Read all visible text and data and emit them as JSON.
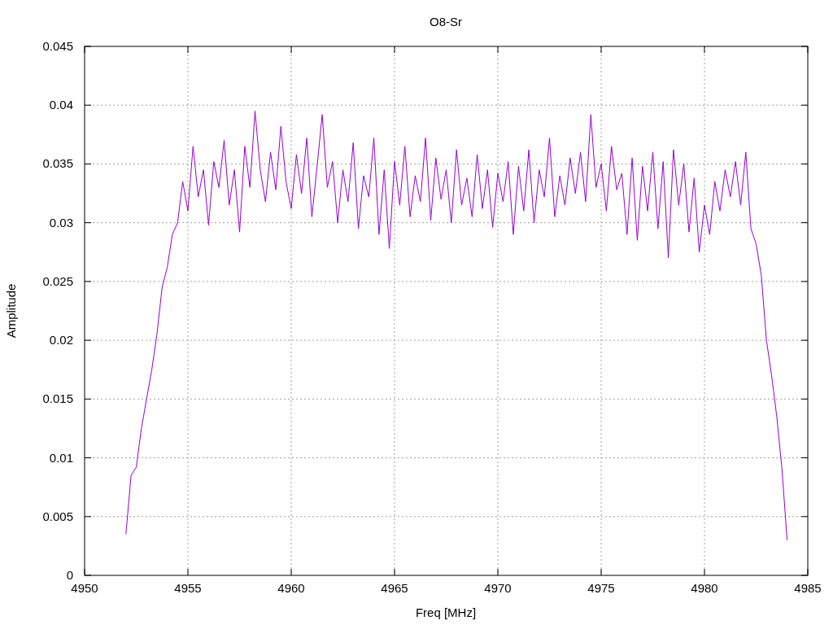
{
  "plot": {
    "chart_data": {
      "type": "line",
      "title": "O8-Sr",
      "xlabel": "Freq [MHz]",
      "ylabel": "Amplitude",
      "grid": true,
      "xlim": [
        4950,
        4985
      ],
      "ylim": [
        0,
        0.045
      ],
      "xticks": [
        4950,
        4955,
        4960,
        4965,
        4970,
        4975,
        4980,
        4985
      ],
      "yticks": [
        0.045,
        0.04,
        0.035,
        0.03,
        0.025,
        0.02,
        0.015,
        0.01,
        0.005,
        0
      ],
      "x": [
        4952,
        4952.25,
        4952.5,
        4952.75,
        4953,
        4953.25,
        4953.5,
        4953.75,
        4954,
        4954.25,
        4954.5,
        4954.75,
        4955,
        4955.25,
        4955.5,
        4955.75,
        4956,
        4956.25,
        4956.5,
        4956.75,
        4957,
        4957.25,
        4957.5,
        4957.75,
        4958,
        4958.25,
        4958.5,
        4958.75,
        4959,
        4959.25,
        4959.5,
        4959.75,
        4960,
        4960.25,
        4960.5,
        4960.75,
        4961,
        4961.25,
        4961.5,
        4961.75,
        4962,
        4962.25,
        4962.5,
        4962.75,
        4963,
        4963.25,
        4963.5,
        4963.75,
        4964,
        4964.25,
        4964.5,
        4964.75,
        4965,
        4965.25,
        4965.5,
        4965.75,
        4966,
        4966.25,
        4966.5,
        4966.75,
        4967,
        4967.25,
        4967.5,
        4967.75,
        4968,
        4968.25,
        4968.5,
        4968.75,
        4969,
        4969.25,
        4969.5,
        4969.75,
        4970,
        4970.25,
        4970.5,
        4970.75,
        4971,
        4971.25,
        4971.5,
        4971.75,
        4972,
        4972.25,
        4972.5,
        4972.75,
        4973,
        4973.25,
        4973.5,
        4973.75,
        4974,
        4974.25,
        4974.5,
        4974.75,
        4975,
        4975.25,
        4975.5,
        4975.75,
        4976,
        4976.25,
        4976.5,
        4976.75,
        4977,
        4977.25,
        4977.5,
        4977.75,
        4978,
        4978.25,
        4978.5,
        4978.75,
        4979,
        4979.25,
        4979.5,
        4979.75,
        4980,
        4980.25,
        4980.5,
        4980.75,
        4981,
        4981.25,
        4981.5,
        4981.75,
        4982,
        4982.25,
        4982.5,
        4982.75,
        4983,
        4983.25,
        4983.5,
        4983.75,
        4984
      ],
      "series": [
        {
          "color": "#9400d3",
          "values": [
            0.0035,
            0.0085,
            0.0092,
            0.0125,
            0.015,
            0.0175,
            0.0205,
            0.0245,
            0.0262,
            0.029,
            0.03,
            0.0335,
            0.031,
            0.0365,
            0.0322,
            0.0345,
            0.0298,
            0.0352,
            0.033,
            0.037,
            0.0315,
            0.0345,
            0.0292,
            0.0365,
            0.033,
            0.0395,
            0.0345,
            0.0318,
            0.036,
            0.0328,
            0.0382,
            0.0335,
            0.0312,
            0.0358,
            0.0325,
            0.0372,
            0.0305,
            0.0348,
            0.0392,
            0.033,
            0.0352,
            0.03,
            0.0345,
            0.0318,
            0.0368,
            0.0295,
            0.034,
            0.0322,
            0.0372,
            0.029,
            0.0345,
            0.0278,
            0.0352,
            0.0315,
            0.0365,
            0.0305,
            0.034,
            0.0318,
            0.0372,
            0.0302,
            0.0355,
            0.032,
            0.0345,
            0.03,
            0.0362,
            0.0315,
            0.0338,
            0.0305,
            0.0358,
            0.0312,
            0.0345,
            0.0296,
            0.0342,
            0.0318,
            0.0352,
            0.029,
            0.0348,
            0.031,
            0.0362,
            0.03,
            0.0345,
            0.0322,
            0.0372,
            0.0305,
            0.034,
            0.0315,
            0.0355,
            0.0325,
            0.036,
            0.0318,
            0.0392,
            0.033,
            0.035,
            0.031,
            0.0365,
            0.0328,
            0.0342,
            0.029,
            0.0355,
            0.0285,
            0.0348,
            0.031,
            0.036,
            0.0295,
            0.0352,
            0.027,
            0.0362,
            0.0315,
            0.035,
            0.0292,
            0.0338,
            0.0275,
            0.0315,
            0.029,
            0.0335,
            0.031,
            0.0345,
            0.0322,
            0.0352,
            0.0315,
            0.036,
            0.0295,
            0.0282,
            0.0255,
            0.02,
            0.017,
            0.0135,
            0.009,
            0.003
          ]
        }
      ]
    }
  }
}
